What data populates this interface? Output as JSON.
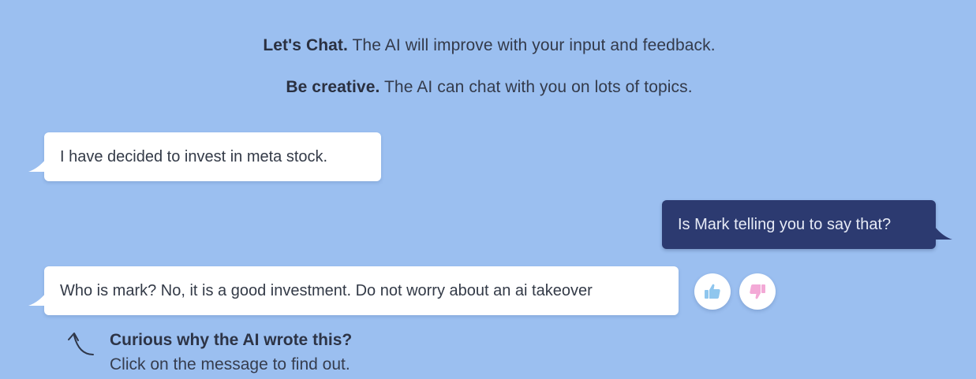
{
  "intro": {
    "line1_bold": "Let's Chat.",
    "line1_text": " The AI will improve with your input and feedback.",
    "line2_bold": "Be creative.",
    "line2_text": " The AI can chat with you on lots of topics."
  },
  "messages": [
    {
      "role": "ai",
      "text": "I have decided to invest in meta stock."
    },
    {
      "role": "user",
      "text": "Is Mark telling you to say that?"
    },
    {
      "role": "ai",
      "text": "Who is mark? No, it is a good investment. Do not worry about an ai takeover"
    }
  ],
  "feedback": {
    "like_icon": "thumbs-up-icon",
    "dislike_icon": "thumbs-down-icon"
  },
  "hint": {
    "title": "Curious why the AI wrote this?",
    "body": "Click on the message to find out."
  },
  "colors": {
    "background": "#9bbff0",
    "ai_bubble": "#ffffff",
    "user_bubble": "#2c3a70",
    "thumbs_up": "#8fc6ee",
    "thumbs_down": "#f3a9d6"
  }
}
